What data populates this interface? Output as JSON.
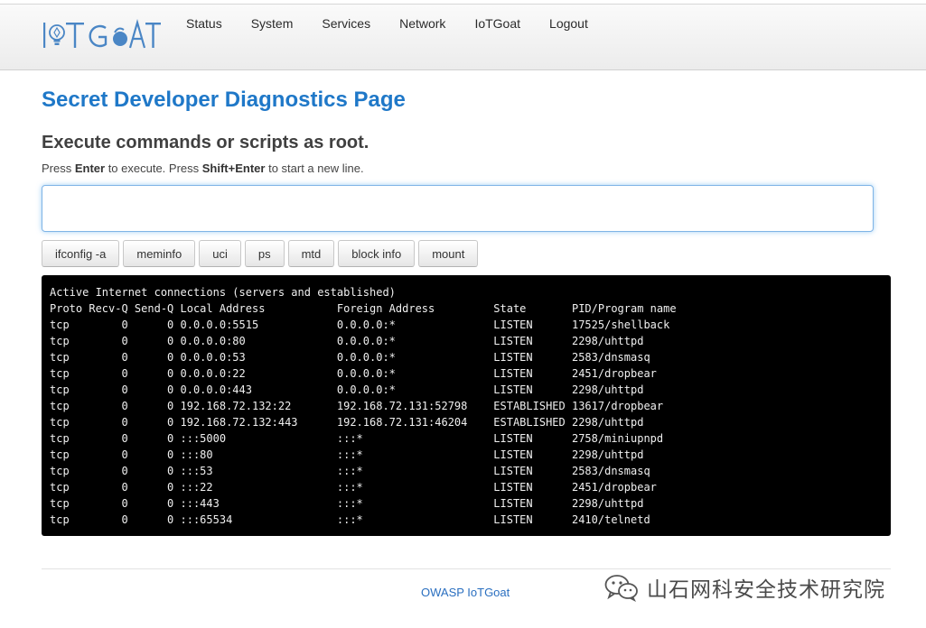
{
  "brand": {
    "name": "IoTGoat"
  },
  "nav": {
    "items": [
      {
        "label": "Status"
      },
      {
        "label": "System"
      },
      {
        "label": "Services"
      },
      {
        "label": "Network"
      },
      {
        "label": "IoTGoat"
      },
      {
        "label": "Logout"
      }
    ]
  },
  "page": {
    "title": "Secret Developer Diagnostics Page",
    "section_title": "Execute commands or scripts as root.",
    "hint": {
      "t1": "Press ",
      "k1": "Enter",
      "t2": " to execute. Press ",
      "k2": "Shift+Enter",
      "t3": " to start a new line."
    }
  },
  "command_input": {
    "value": "",
    "placeholder": ""
  },
  "buttons": [
    {
      "label": "ifconfig -a"
    },
    {
      "label": "meminfo"
    },
    {
      "label": "uci"
    },
    {
      "label": "ps"
    },
    {
      "label": "mtd"
    },
    {
      "label": "block info"
    },
    {
      "label": "mount"
    }
  ],
  "console": {
    "lines": [
      "Active Internet connections (servers and established)",
      "Proto Recv-Q Send-Q Local Address           Foreign Address         State       PID/Program name",
      "tcp        0      0 0.0.0.0:5515            0.0.0.0:*               LISTEN      17525/shellback",
      "tcp        0      0 0.0.0.0:80              0.0.0.0:*               LISTEN      2298/uhttpd",
      "tcp        0      0 0.0.0.0:53              0.0.0.0:*               LISTEN      2583/dnsmasq",
      "tcp        0      0 0.0.0.0:22              0.0.0.0:*               LISTEN      2451/dropbear",
      "tcp        0      0 0.0.0.0:443             0.0.0.0:*               LISTEN      2298/uhttpd",
      "tcp        0      0 192.168.72.132:22       192.168.72.131:52798    ESTABLISHED 13617/dropbear",
      "tcp        0      0 192.168.72.132:443      192.168.72.131:46204    ESTABLISHED 2298/uhttpd",
      "tcp        0      0 :::5000                 :::*                    LISTEN      2758/miniupnpd",
      "tcp        0      0 :::80                   :::*                    LISTEN      2298/uhttpd",
      "tcp        0      0 :::53                   :::*                    LISTEN      2583/dnsmasq",
      "tcp        0      0 :::22                   :::*                    LISTEN      2451/dropbear",
      "tcp        0      0 :::443                  :::*                    LISTEN      2298/uhttpd",
      "tcp        0      0 :::65534                :::*                    LISTEN      2410/telnetd"
    ]
  },
  "footer": {
    "link": "OWASP IoTGoat"
  },
  "watermark": {
    "text": "山石网科安全技术研究院",
    "icon": "wechat-icon"
  },
  "colors": {
    "title_blue": "#1f78c8",
    "link_blue": "#2a6fc0",
    "console_bg": "#000000",
    "input_focus": "#7fb4e6"
  }
}
